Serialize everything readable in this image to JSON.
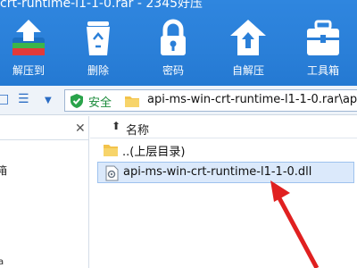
{
  "window": {
    "title": "crt-runtime-l1-1-0.rar - 2345好压"
  },
  "toolbar": {
    "items": [
      {
        "label": "解压到",
        "icon": "extract-icon"
      },
      {
        "label": "删除",
        "icon": "recycle-bin-icon"
      },
      {
        "label": "密码",
        "icon": "lock-icon"
      },
      {
        "label": "自解压",
        "icon": "upload-house-icon"
      },
      {
        "label": "工具箱",
        "icon": "toolbox-icon"
      }
    ]
  },
  "address_bar": {
    "secure_label": "安全",
    "path": "api-ms-win-crt-runtime-l1-1-0.rar\\api"
  },
  "left_pane": {
    "fragments": [
      "箱",
      "a"
    ]
  },
  "file_list": {
    "column_name": "名称",
    "rows": [
      {
        "name": "..(上层目录)",
        "icon": "folder-icon",
        "selected": false
      },
      {
        "name": "api-ms-win-crt-runtime-l1-1-0.dll",
        "icon": "dll-file-icon",
        "selected": true
      }
    ]
  },
  "colors": {
    "toolbar_blue": "#2a7fd8",
    "selection": "#dbe9fb",
    "arrow": "#e02020"
  }
}
